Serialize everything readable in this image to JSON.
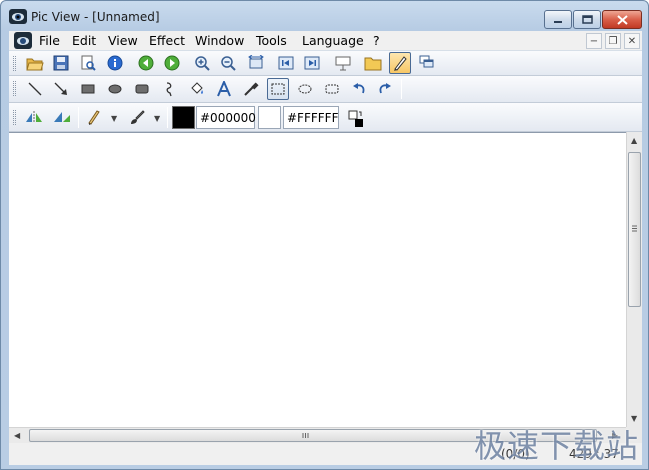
{
  "window": {
    "title": "Pic View - [Unnamed]",
    "caption_buttons": [
      "minimize-icon",
      "maximize-icon",
      "close-icon"
    ]
  },
  "menubar": {
    "items": [
      "File",
      "Edit",
      "View",
      "Effect",
      "Window",
      "Tools",
      "Language",
      "?"
    ],
    "mdi_buttons": [
      "−",
      "❐",
      "✕"
    ]
  },
  "toolbar1": {
    "icons": [
      "open-folder-icon",
      "save-icon",
      "print-preview-icon",
      "info-icon",
      "previous-icon",
      "next-icon",
      "zoom-in-icon",
      "zoom-out-icon",
      "fit-size-icon",
      "first-icon",
      "last-icon",
      "slideshow-icon",
      "browse-folder-icon",
      "edit-mode-icon",
      "windows-icon"
    ]
  },
  "toolbar2": {
    "icons": [
      "line-icon",
      "arrow-icon",
      "filled-rectangle-icon",
      "filled-ellipse-icon",
      "rounded-rectangle-icon",
      "lasso-icon",
      "fill-icon",
      "text-icon",
      "color-picker-icon",
      "rect-select-icon",
      "ellipse-select-icon",
      "rounded-select-icon",
      "undo-icon",
      "redo-icon"
    ]
  },
  "toolbar3": {
    "icons": [
      "flip-horizontal-icon",
      "flip-vertical-icon",
      "pencil-icon",
      "brush-icon"
    ],
    "foreground_color": "#000000",
    "background_color": "#FFFFFF"
  },
  "status": {
    "index": "(0/0)",
    "position": "429 : 37"
  },
  "watermark": "极速下载站",
  "colors": {
    "frame": "#b9cde4",
    "accent": "#f7c766"
  }
}
